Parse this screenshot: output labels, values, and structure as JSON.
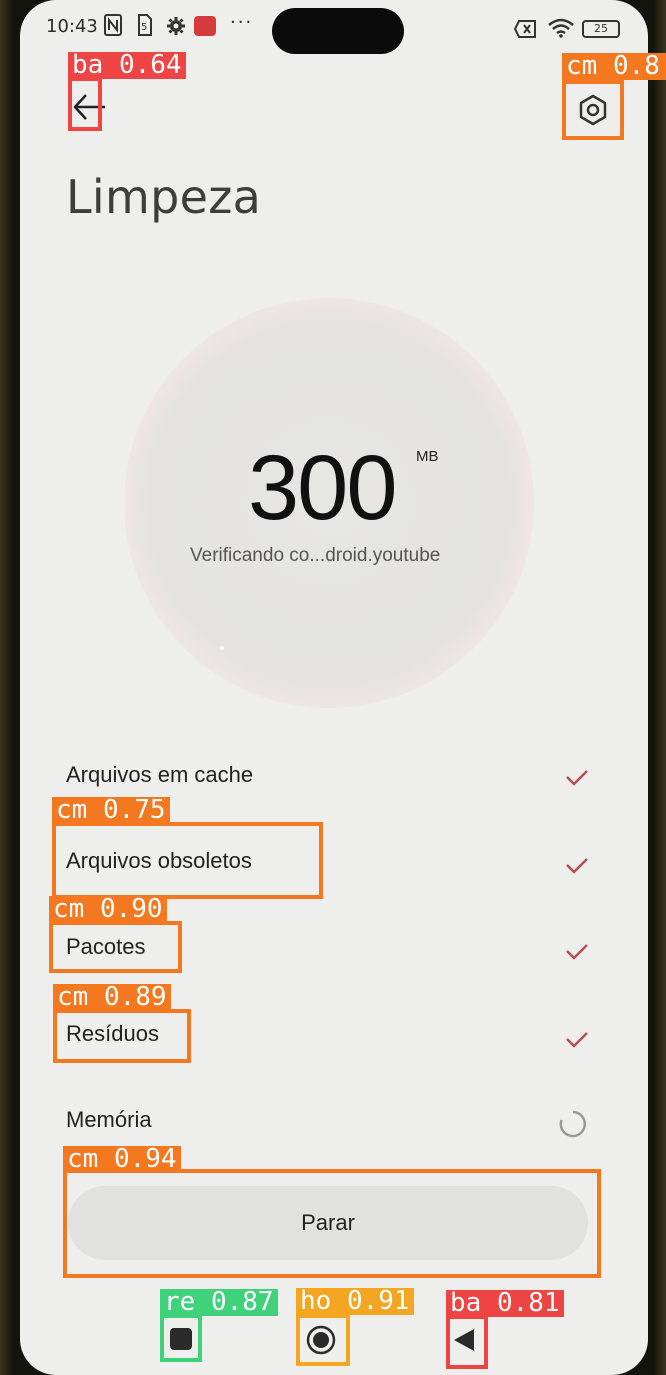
{
  "status_bar": {
    "time": "10:43",
    "battery": "25",
    "icons": [
      "nfc-icon",
      "sim-icon",
      "gear-icon",
      "app-notification-icon",
      "more-dots-icon",
      "wifi-icon",
      "battery-icon"
    ]
  },
  "header": {
    "back_icon": "arrow-left-icon",
    "settings_icon": "hexagon-settings-icon",
    "title": "Limpeza"
  },
  "scan": {
    "value": "300",
    "unit": "MB",
    "status_text": "Verificando co...droid.youtube"
  },
  "categories": [
    {
      "label": "Arquivos em cache",
      "state": "done"
    },
    {
      "label": "Arquivos obsoletos",
      "state": "done"
    },
    {
      "label": "Pacotes",
      "state": "done"
    },
    {
      "label": "Resíduos",
      "state": "done"
    },
    {
      "label": "Memória",
      "state": "loading"
    }
  ],
  "stop_button": {
    "label": "Parar"
  },
  "nav_bar": {
    "recents_icon": "square-icon",
    "home_icon": "circle-home-icon",
    "back_icon": "triangle-back-icon"
  },
  "detections": [
    {
      "label": "ba 0.64",
      "color": "#ee4444"
    },
    {
      "label": "cm 0.8",
      "color": "#f4781f"
    },
    {
      "label": "cm 0.75",
      "color": "#f4781f"
    },
    {
      "label": "cm 0.90",
      "color": "#f4781f"
    },
    {
      "label": "cm 0.89",
      "color": "#f4781f"
    },
    {
      "label": "cm 0.94",
      "color": "#f4781f"
    },
    {
      "label": "re 0.87",
      "color": "#3fd27a"
    },
    {
      "label": "ho 0.91",
      "color": "#f4a623"
    },
    {
      "label": "ba 0.81",
      "color": "#ee4444"
    }
  ],
  "colors": {
    "background": "#eeeeec",
    "check": "#b25050",
    "ring": "#f2dbdd"
  }
}
